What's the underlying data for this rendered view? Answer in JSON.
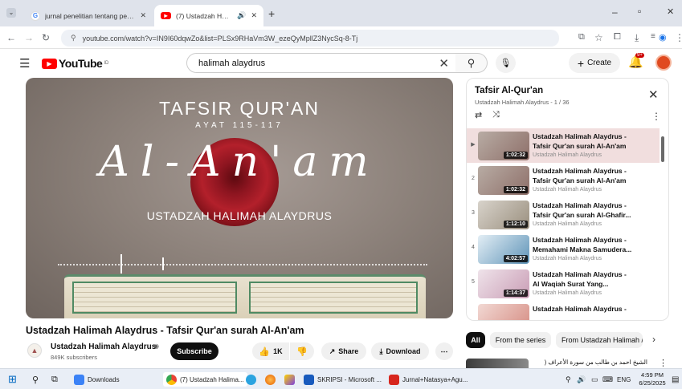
{
  "browser": {
    "tabs": [
      {
        "title": "jurnal penelitian tentang peren",
        "active": false
      },
      {
        "title": "(7) Ustadzah Halimah Alayd",
        "active": true
      }
    ],
    "new_tab": "+",
    "url": "youtube.com/watch?v=IN9I60dqwZo&list=PLSx9RHaVm3W_ezeQyMpllZ3NycSq-8-Tj",
    "window_min": "–",
    "window_max": "▫",
    "window_close": "✕"
  },
  "youtube": {
    "logo_text": "YouTube",
    "logo_sup": "ID",
    "search_value": "halimah alaydrus",
    "create_label": "Create",
    "notif_count": "9+"
  },
  "video": {
    "overlay_title": "TAFSIR QUR'AN",
    "overlay_ayat": "AYAT 115-117",
    "overlay_script": "Al-An'am",
    "overlay_speaker": "USTADZAH HALIMAH ALAYDRUS",
    "title": "Ustadzah Halimah Alaydrus - Tafsir Qur'an surah Al-An'am",
    "channel": "Ustadzah Halimah Alaydrus",
    "subscribers": "849K subscribers",
    "subscribe_label": "Subscribe",
    "likes": "1K",
    "share_label": "Share",
    "download_label": "Download"
  },
  "playlist": {
    "title": "Tafsir Al-Qur'an",
    "meta": "Ustadzah Halimah Alaydrus - 1 / 36",
    "items": [
      {
        "index": "▶",
        "line1": "Ustadzah Halimah Alaydrus -",
        "line2": "Tafsir Qur'an surah Al-An'am",
        "channel": "Ustadzah Halimah Alaydrus",
        "duration": "1:02:32"
      },
      {
        "index": "2",
        "line1": "Ustadzah Halimah Alaydrus -",
        "line2": "Tafsir Qur'an surah Al-An'am",
        "channel": "Ustadzah Halimah Alaydrus",
        "duration": "1:02:32"
      },
      {
        "index": "3",
        "line1": "Ustadzah Halimah Alaydrus -",
        "line2": "Tafsir Qur'an surah Al-Ghafir...",
        "channel": "Ustadzah Halimah Alaydrus",
        "duration": "1:12:10"
      },
      {
        "index": "4",
        "line1": "Ustadzah Halimah Alaydrus -",
        "line2": "Memahami Makna Samudera...",
        "channel": "Ustadzah Halimah Alaydrus",
        "duration": "4:02:57"
      },
      {
        "index": "5",
        "line1": "Ustadzah Halimah Alaydrus -",
        "line2": "Al Waqiah Surat Yang...",
        "channel": "Ustadzah Halimah Alaydrus",
        "duration": "1:14:37"
      },
      {
        "index": "",
        "line1": "Ustadzah Halimah Alaydrus -",
        "line2": "",
        "channel": "",
        "duration": ""
      }
    ]
  },
  "chips": {
    "all": "All",
    "series": "From the series",
    "channel": "From Ustadzah Halimah /"
  },
  "recommend": {
    "arabic_title": "الشيخ احمد بن طالب من سورة الأعراف ("
  },
  "taskbar": {
    "downloads": "Downloads",
    "chrome": "(7) Ustadzah Halima...",
    "word": "SKRIPSI - Microsoft ...",
    "acrobat": "Jurnal+Natasya+Agu...",
    "lang": "ENG",
    "time": "4:59 PM",
    "date": "6/25/2025"
  },
  "colors": {
    "youtube_red": "#ff0000",
    "subscribe_bg": "#0f0f0f",
    "current_item": "#f1dede"
  }
}
